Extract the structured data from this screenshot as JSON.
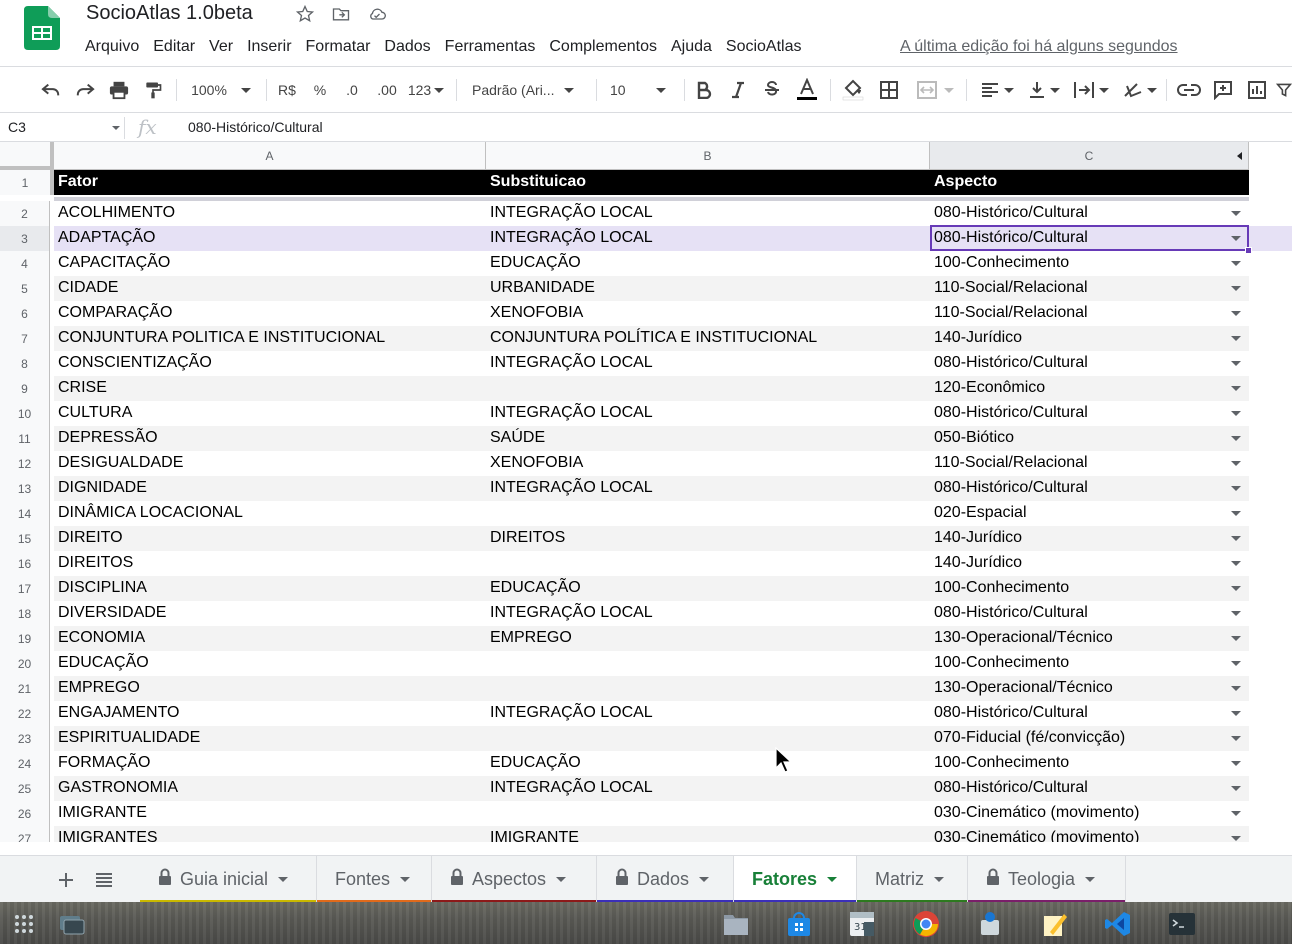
{
  "doc": {
    "title": "SocioAtlas 1.0beta",
    "last_edit": "A última edição foi há alguns segundos"
  },
  "menu": [
    "Arquivo",
    "Editar",
    "Ver",
    "Inserir",
    "Formatar",
    "Dados",
    "Ferramentas",
    "Complementos",
    "Ajuda",
    "SocioAtlas"
  ],
  "toolbar": {
    "zoom": "100%",
    "currency": "R$",
    "percent": "%",
    "decrease_decimal": ".0",
    "increase_decimal": ".00",
    "more_formats": "123",
    "font": "Padrão (Ari...",
    "font_size": "10"
  },
  "formula_bar": {
    "cell_ref": "C3",
    "fx": "fx",
    "value": "080-Histórico/Cultural"
  },
  "columns": [
    "A",
    "B",
    "C"
  ],
  "header_row": {
    "num": "1",
    "a": "Fator",
    "b": "Substituicao",
    "c": "Aspecto"
  },
  "rows": [
    {
      "num": "2",
      "a": "ACOLHIMENTO",
      "b": "INTEGRAÇÃO LOCAL",
      "c": "080-Histórico/Cultural"
    },
    {
      "num": "3",
      "a": "ADAPTAÇÃO",
      "b": "INTEGRAÇÃO LOCAL",
      "c": "080-Histórico/Cultural"
    },
    {
      "num": "4",
      "a": "CAPACITAÇÃO",
      "b": "EDUCAÇÃO",
      "c": "100-Conhecimento"
    },
    {
      "num": "5",
      "a": "CIDADE",
      "b": "URBANIDADE",
      "c": "110-Social/Relacional"
    },
    {
      "num": "6",
      "a": "COMPARAÇÃO",
      "b": "XENOFOBIA",
      "c": "110-Social/Relacional"
    },
    {
      "num": "7",
      "a": "CONJUNTURA POLITICA E INSTITUCIONAL",
      "b": "CONJUNTURA POLÍTICA E INSTITUCIONAL",
      "c": "140-Jurídico"
    },
    {
      "num": "8",
      "a": "CONSCIENTIZAÇÃO",
      "b": "INTEGRAÇÃO LOCAL",
      "c": "080-Histórico/Cultural"
    },
    {
      "num": "9",
      "a": "CRISE",
      "b": "",
      "c": "120-Econômico"
    },
    {
      "num": "10",
      "a": "CULTURA",
      "b": "INTEGRAÇÃO LOCAL",
      "c": "080-Histórico/Cultural"
    },
    {
      "num": "11",
      "a": "DEPRESSÃO",
      "b": "SAÚDE",
      "c": "050-Biótico"
    },
    {
      "num": "12",
      "a": "DESIGUALDADE",
      "b": "XENOFOBIA",
      "c": "110-Social/Relacional"
    },
    {
      "num": "13",
      "a": "DIGNIDADE",
      "b": "INTEGRAÇÃO LOCAL",
      "c": "080-Histórico/Cultural"
    },
    {
      "num": "14",
      "a": "DINÂMICA LOCACIONAL",
      "b": "",
      "c": "020-Espacial"
    },
    {
      "num": "15",
      "a": "DIREITO",
      "b": "DIREITOS",
      "c": "140-Jurídico"
    },
    {
      "num": "16",
      "a": "DIREITOS",
      "b": "",
      "c": "140-Jurídico"
    },
    {
      "num": "17",
      "a": "DISCIPLINA",
      "b": "EDUCAÇÃO",
      "c": "100-Conhecimento"
    },
    {
      "num": "18",
      "a": "DIVERSIDADE",
      "b": "INTEGRAÇÃO LOCAL",
      "c": "080-Histórico/Cultural"
    },
    {
      "num": "19",
      "a": "ECONOMIA",
      "b": "EMPREGO",
      "c": "130-Operacional/Técnico"
    },
    {
      "num": "20",
      "a": "EDUCAÇÃO",
      "b": "",
      "c": "100-Conhecimento"
    },
    {
      "num": "21",
      "a": "EMPREGO",
      "b": "",
      "c": "130-Operacional/Técnico"
    },
    {
      "num": "22",
      "a": "ENGAJAMENTO",
      "b": "INTEGRAÇÃO LOCAL",
      "c": "080-Histórico/Cultural"
    },
    {
      "num": "23",
      "a": "ESPIRITUALIDADE",
      "b": "",
      "c": "070-Fiducial (fé/convicção)"
    },
    {
      "num": "24",
      "a": "FORMAÇÃO",
      "b": "EDUCAÇÃO",
      "c": "100-Conhecimento"
    },
    {
      "num": "25",
      "a": "GASTRONOMIA",
      "b": "INTEGRAÇÃO LOCAL",
      "c": "080-Histórico/Cultural"
    },
    {
      "num": "26",
      "a": "IMIGRANTE",
      "b": "",
      "c": "030-Cinemático (movimento)"
    },
    {
      "num": "27",
      "a": "IMIGRANTES",
      "b": "IMIGRANTE",
      "c": "030-Cinemático (movimento)"
    }
  ],
  "tabs": [
    {
      "label": "Guia inicial",
      "locked": true,
      "color": "#c9b800",
      "active": false
    },
    {
      "label": "Fontes",
      "locked": false,
      "color": "#e06a1b",
      "active": false
    },
    {
      "label": "Aspectos",
      "locked": true,
      "color": "#8c1a1a",
      "active": false
    },
    {
      "label": "Dados",
      "locked": true,
      "color": "#3b2fb8",
      "active": false
    },
    {
      "label": "Fatores",
      "locked": false,
      "color": "#3b2fb8",
      "active": true
    },
    {
      "label": "Matriz",
      "locked": false,
      "color": "#2d7a1f",
      "active": false
    },
    {
      "label": "Teologia",
      "locked": true,
      "color": "#7a1f6a",
      "active": false
    }
  ],
  "taskbar_apps": [
    "files-icon",
    "store-icon",
    "calendar-icon",
    "chrome-icon",
    "package-icon",
    "text-editor-icon",
    "vscode-icon",
    "terminal-icon"
  ],
  "taskbar_calendar_day": "31",
  "colors": {
    "accent": "#188038",
    "selection": "#673ab7",
    "header_bg": "#000000"
  }
}
